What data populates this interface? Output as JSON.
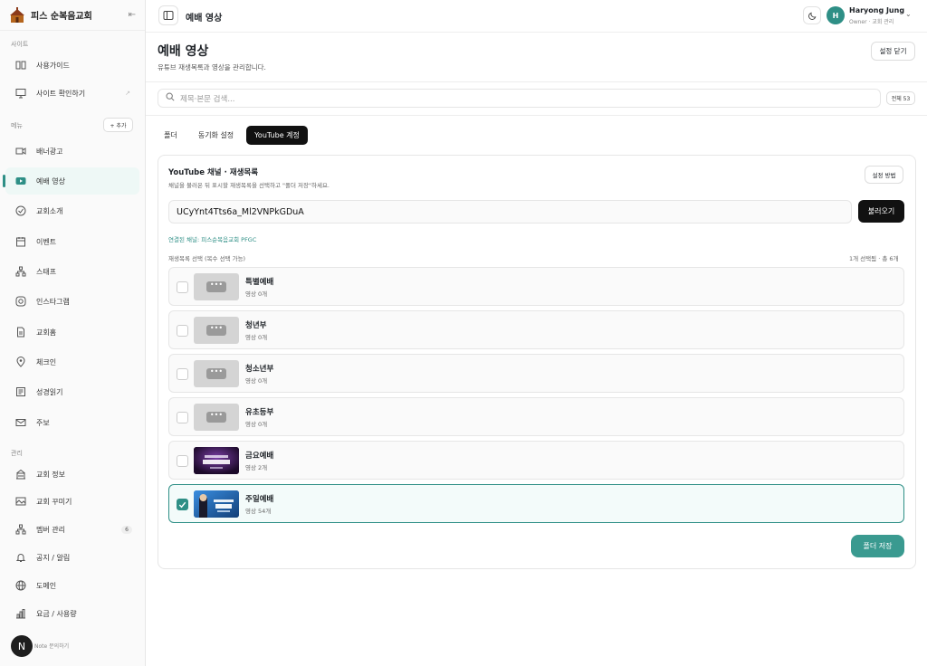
{
  "brand": {
    "name": "피스 순복음교회"
  },
  "sidebar": {
    "section_site": "사이트",
    "site_items": [
      {
        "label": "사용가이드"
      },
      {
        "label": "사이트 확인하기"
      }
    ],
    "section_menu": "메뉴",
    "add_label": "+ 추가",
    "menu_items": [
      {
        "label": "배너광고"
      },
      {
        "label": "예배 영상"
      },
      {
        "label": "교회소개"
      },
      {
        "label": "이벤트"
      },
      {
        "label": "스태프"
      },
      {
        "label": "인스타그램"
      },
      {
        "label": "교회홈"
      },
      {
        "label": "체크인"
      },
      {
        "label": "성경읽기"
      },
      {
        "label": "주보"
      }
    ],
    "section_admin": "관리",
    "admin_items": [
      {
        "label": "교회 정보"
      },
      {
        "label": "교회 꾸미기"
      },
      {
        "label": "멤버 관리",
        "badge": "6"
      },
      {
        "label": "공지 / 알림"
      },
      {
        "label": "도메인"
      },
      {
        "label": "요금 / 사용량"
      }
    ],
    "help": {
      "fab": "N",
      "label": "Note 문의하기"
    }
  },
  "header": {
    "title": "예배 영상",
    "user": {
      "initial": "H",
      "name": "Haryong Jung",
      "role": "Owner · 교회 관리"
    }
  },
  "main": {
    "title": "예배 영상",
    "subtitle": "유튜브 재생목록과 영상을 관리합니다.",
    "close_settings": "설정 닫기",
    "search_placeholder": "제목·본문 검색...",
    "total_badge": "전체 53",
    "tabs": [
      {
        "label": "폴더"
      },
      {
        "label": "동기화 설정"
      },
      {
        "label": "YouTube 계정"
      }
    ],
    "active_tab": 2
  },
  "youtube": {
    "title": "YouTube 채널 · 재생목록",
    "desc": "채널을 불러온 뒤 표시할 재생목록을 선택하고 \"폴더 저장\"하세요.",
    "howto": "설정 방법",
    "channel_id": "UCyYnt4Tts6a_Ml2VNPkGDuA",
    "load_button": "불러오기",
    "linked_channel": "연결된 채널: 피스순복음교회 PFGC",
    "playlist_label": "재생목록 선택 (복수 선택 가능)",
    "playlist_count": "1개 선택됨 · 총 6개",
    "playlists": [
      {
        "name": "특별예배",
        "count": "영상 0개",
        "selected": false,
        "thumb": "placeholder"
      },
      {
        "name": "청년부",
        "count": "영상 0개",
        "selected": false,
        "thumb": "placeholder"
      },
      {
        "name": "청소년부",
        "count": "영상 0개",
        "selected": false,
        "thumb": "placeholder"
      },
      {
        "name": "유초등부",
        "count": "영상 0개",
        "selected": false,
        "thumb": "placeholder"
      },
      {
        "name": "금요예배",
        "count": "영상 2개",
        "selected": false,
        "thumb": "friday-worship"
      },
      {
        "name": "주일예배",
        "count": "영상 54개",
        "selected": true,
        "thumb": "sunday-worship"
      }
    ],
    "save_button": "폴더 저장"
  },
  "colors": {
    "accent": "#2e8f86",
    "dark": "#111111"
  }
}
